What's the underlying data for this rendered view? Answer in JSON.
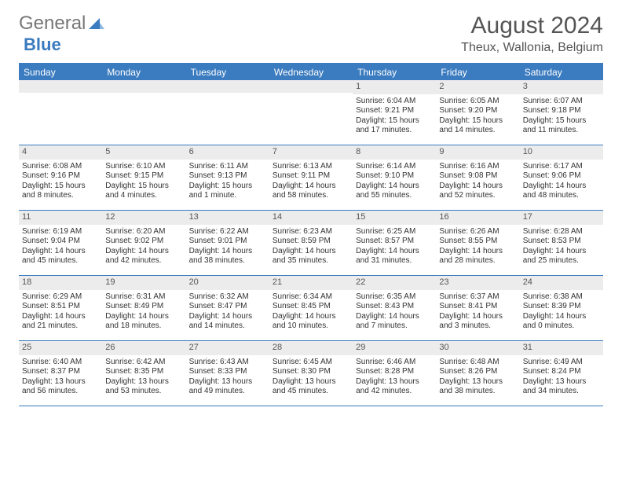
{
  "brand": {
    "part1": "General",
    "part2": "Blue"
  },
  "title": "August 2024",
  "location": "Theux, Wallonia, Belgium",
  "dow": [
    "Sunday",
    "Monday",
    "Tuesday",
    "Wednesday",
    "Thursday",
    "Friday",
    "Saturday"
  ],
  "weeks": [
    [
      null,
      null,
      null,
      null,
      {
        "n": "1",
        "sunrise": "Sunrise: 6:04 AM",
        "sunset": "Sunset: 9:21 PM",
        "daylight": "Daylight: 15 hours and 17 minutes."
      },
      {
        "n": "2",
        "sunrise": "Sunrise: 6:05 AM",
        "sunset": "Sunset: 9:20 PM",
        "daylight": "Daylight: 15 hours and 14 minutes."
      },
      {
        "n": "3",
        "sunrise": "Sunrise: 6:07 AM",
        "sunset": "Sunset: 9:18 PM",
        "daylight": "Daylight: 15 hours and 11 minutes."
      }
    ],
    [
      {
        "n": "4",
        "sunrise": "Sunrise: 6:08 AM",
        "sunset": "Sunset: 9:16 PM",
        "daylight": "Daylight: 15 hours and 8 minutes."
      },
      {
        "n": "5",
        "sunrise": "Sunrise: 6:10 AM",
        "sunset": "Sunset: 9:15 PM",
        "daylight": "Daylight: 15 hours and 4 minutes."
      },
      {
        "n": "6",
        "sunrise": "Sunrise: 6:11 AM",
        "sunset": "Sunset: 9:13 PM",
        "daylight": "Daylight: 15 hours and 1 minute."
      },
      {
        "n": "7",
        "sunrise": "Sunrise: 6:13 AM",
        "sunset": "Sunset: 9:11 PM",
        "daylight": "Daylight: 14 hours and 58 minutes."
      },
      {
        "n": "8",
        "sunrise": "Sunrise: 6:14 AM",
        "sunset": "Sunset: 9:10 PM",
        "daylight": "Daylight: 14 hours and 55 minutes."
      },
      {
        "n": "9",
        "sunrise": "Sunrise: 6:16 AM",
        "sunset": "Sunset: 9:08 PM",
        "daylight": "Daylight: 14 hours and 52 minutes."
      },
      {
        "n": "10",
        "sunrise": "Sunrise: 6:17 AM",
        "sunset": "Sunset: 9:06 PM",
        "daylight": "Daylight: 14 hours and 48 minutes."
      }
    ],
    [
      {
        "n": "11",
        "sunrise": "Sunrise: 6:19 AM",
        "sunset": "Sunset: 9:04 PM",
        "daylight": "Daylight: 14 hours and 45 minutes."
      },
      {
        "n": "12",
        "sunrise": "Sunrise: 6:20 AM",
        "sunset": "Sunset: 9:02 PM",
        "daylight": "Daylight: 14 hours and 42 minutes."
      },
      {
        "n": "13",
        "sunrise": "Sunrise: 6:22 AM",
        "sunset": "Sunset: 9:01 PM",
        "daylight": "Daylight: 14 hours and 38 minutes."
      },
      {
        "n": "14",
        "sunrise": "Sunrise: 6:23 AM",
        "sunset": "Sunset: 8:59 PM",
        "daylight": "Daylight: 14 hours and 35 minutes."
      },
      {
        "n": "15",
        "sunrise": "Sunrise: 6:25 AM",
        "sunset": "Sunset: 8:57 PM",
        "daylight": "Daylight: 14 hours and 31 minutes."
      },
      {
        "n": "16",
        "sunrise": "Sunrise: 6:26 AM",
        "sunset": "Sunset: 8:55 PM",
        "daylight": "Daylight: 14 hours and 28 minutes."
      },
      {
        "n": "17",
        "sunrise": "Sunrise: 6:28 AM",
        "sunset": "Sunset: 8:53 PM",
        "daylight": "Daylight: 14 hours and 25 minutes."
      }
    ],
    [
      {
        "n": "18",
        "sunrise": "Sunrise: 6:29 AM",
        "sunset": "Sunset: 8:51 PM",
        "daylight": "Daylight: 14 hours and 21 minutes."
      },
      {
        "n": "19",
        "sunrise": "Sunrise: 6:31 AM",
        "sunset": "Sunset: 8:49 PM",
        "daylight": "Daylight: 14 hours and 18 minutes."
      },
      {
        "n": "20",
        "sunrise": "Sunrise: 6:32 AM",
        "sunset": "Sunset: 8:47 PM",
        "daylight": "Daylight: 14 hours and 14 minutes."
      },
      {
        "n": "21",
        "sunrise": "Sunrise: 6:34 AM",
        "sunset": "Sunset: 8:45 PM",
        "daylight": "Daylight: 14 hours and 10 minutes."
      },
      {
        "n": "22",
        "sunrise": "Sunrise: 6:35 AM",
        "sunset": "Sunset: 8:43 PM",
        "daylight": "Daylight: 14 hours and 7 minutes."
      },
      {
        "n": "23",
        "sunrise": "Sunrise: 6:37 AM",
        "sunset": "Sunset: 8:41 PM",
        "daylight": "Daylight: 14 hours and 3 minutes."
      },
      {
        "n": "24",
        "sunrise": "Sunrise: 6:38 AM",
        "sunset": "Sunset: 8:39 PM",
        "daylight": "Daylight: 14 hours and 0 minutes."
      }
    ],
    [
      {
        "n": "25",
        "sunrise": "Sunrise: 6:40 AM",
        "sunset": "Sunset: 8:37 PM",
        "daylight": "Daylight: 13 hours and 56 minutes."
      },
      {
        "n": "26",
        "sunrise": "Sunrise: 6:42 AM",
        "sunset": "Sunset: 8:35 PM",
        "daylight": "Daylight: 13 hours and 53 minutes."
      },
      {
        "n": "27",
        "sunrise": "Sunrise: 6:43 AM",
        "sunset": "Sunset: 8:33 PM",
        "daylight": "Daylight: 13 hours and 49 minutes."
      },
      {
        "n": "28",
        "sunrise": "Sunrise: 6:45 AM",
        "sunset": "Sunset: 8:30 PM",
        "daylight": "Daylight: 13 hours and 45 minutes."
      },
      {
        "n": "29",
        "sunrise": "Sunrise: 6:46 AM",
        "sunset": "Sunset: 8:28 PM",
        "daylight": "Daylight: 13 hours and 42 minutes."
      },
      {
        "n": "30",
        "sunrise": "Sunrise: 6:48 AM",
        "sunset": "Sunset: 8:26 PM",
        "daylight": "Daylight: 13 hours and 38 minutes."
      },
      {
        "n": "31",
        "sunrise": "Sunrise: 6:49 AM",
        "sunset": "Sunset: 8:24 PM",
        "daylight": "Daylight: 13 hours and 34 minutes."
      }
    ]
  ]
}
